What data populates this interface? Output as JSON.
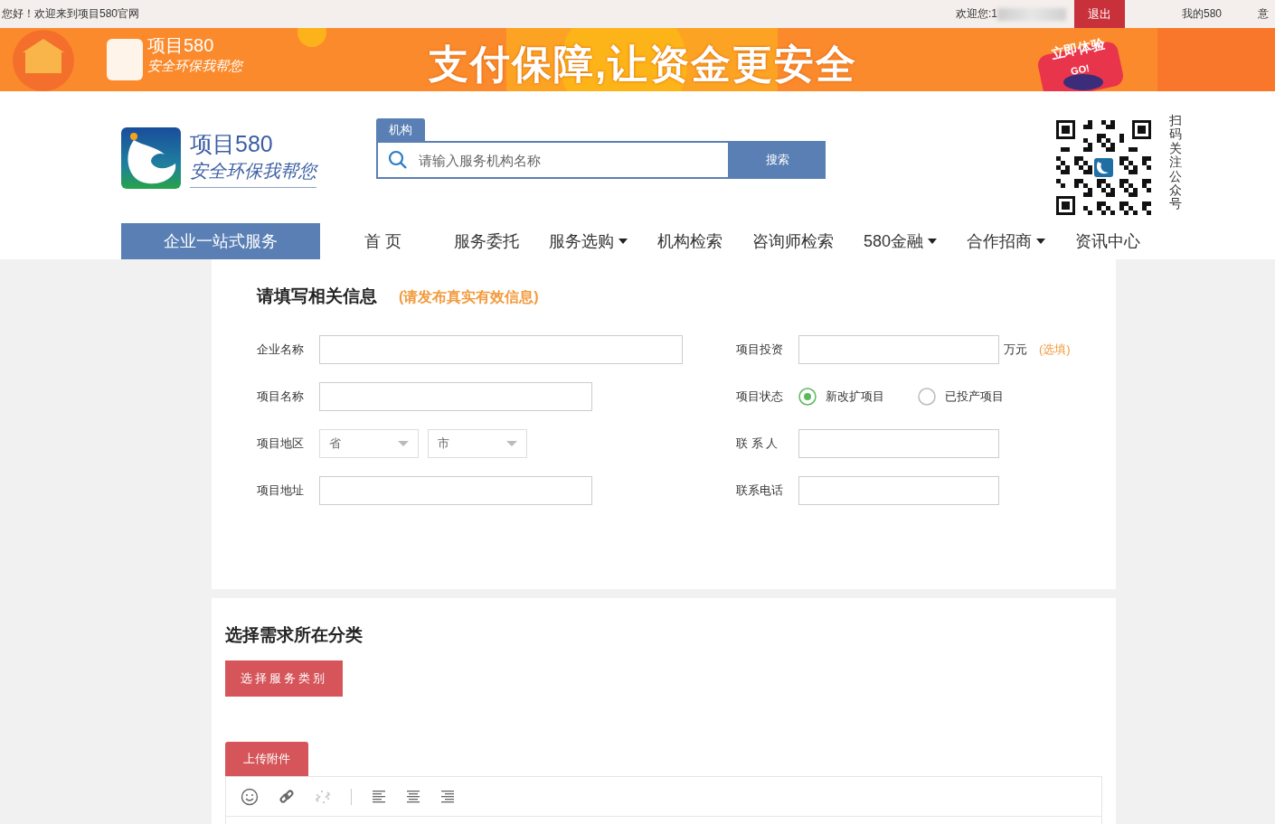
{
  "top_bar": {
    "greeting": "您好！欢迎来到项目580官网",
    "welcome": "欢迎您:1",
    "logout_button": "退出",
    "links": [
      "我的580",
      "意"
    ]
  },
  "banner": {
    "logo_title": "项目580",
    "logo_slogan": "安全环保我帮您",
    "headline": "支付保障,让资金更安全",
    "badge_title": "立即体验",
    "badge_go": "GO!"
  },
  "header": {
    "logo": {
      "title": "项目580",
      "slogan": "安全环保我帮您"
    },
    "search": {
      "tab": "机构",
      "placeholder": "请输入服务机构名称",
      "button": "搜索"
    },
    "qr_caption": "扫码关注公众号"
  },
  "nav": {
    "service_button": "企业一站式服务",
    "items": [
      {
        "label": "首 页",
        "dropdown": false
      },
      {
        "label": "服务委托",
        "dropdown": false
      },
      {
        "label": "服务选购",
        "dropdown": true
      },
      {
        "label": "机构检索",
        "dropdown": false
      },
      {
        "label": "咨询师检索",
        "dropdown": false
      },
      {
        "label": "580金融",
        "dropdown": true
      },
      {
        "label": "合作招商",
        "dropdown": true
      },
      {
        "label": "资讯中心",
        "dropdown": false
      }
    ]
  },
  "form": {
    "title": "请填写相关信息",
    "hint": "(请发布真实有效信息)",
    "rows": [
      {
        "left": {
          "kind": "input",
          "label": "企业名称"
        },
        "right": {
          "kind": "input_unit",
          "label": "项目投资",
          "unit": "万元",
          "note": "(选填)"
        }
      },
      {
        "left": {
          "kind": "input",
          "label": "项目名称"
        },
        "right": {
          "kind": "radios",
          "label": "项目状态",
          "options": [
            {
              "label": "新改扩项目",
              "selected": true
            },
            {
              "label": "已投产项目",
              "selected": false
            }
          ]
        }
      },
      {
        "left": {
          "kind": "selects",
          "label": "项目地区",
          "selects": [
            {
              "placeholder": "省"
            },
            {
              "placeholder": "市"
            }
          ]
        },
        "right": {
          "kind": "input",
          "label": "联 系 人"
        }
      },
      {
        "left": {
          "kind": "input",
          "label": "项目地址"
        },
        "right": {
          "kind": "input",
          "label": "联系电话"
        }
      }
    ]
  },
  "category": {
    "title": "选择需求所在分类",
    "button": "选择服务类别",
    "upload_button": "上传附件"
  },
  "editor": {
    "tools": [
      {
        "kind": "emoji",
        "disabled": false
      },
      {
        "kind": "link",
        "disabled": false
      },
      {
        "kind": "unlink",
        "disabled": true
      },
      {
        "kind": "separator"
      },
      {
        "kind": "align-left",
        "disabled": false
      },
      {
        "kind": "align-center",
        "disabled": false
      },
      {
        "kind": "align-right",
        "disabled": false
      }
    ]
  }
}
